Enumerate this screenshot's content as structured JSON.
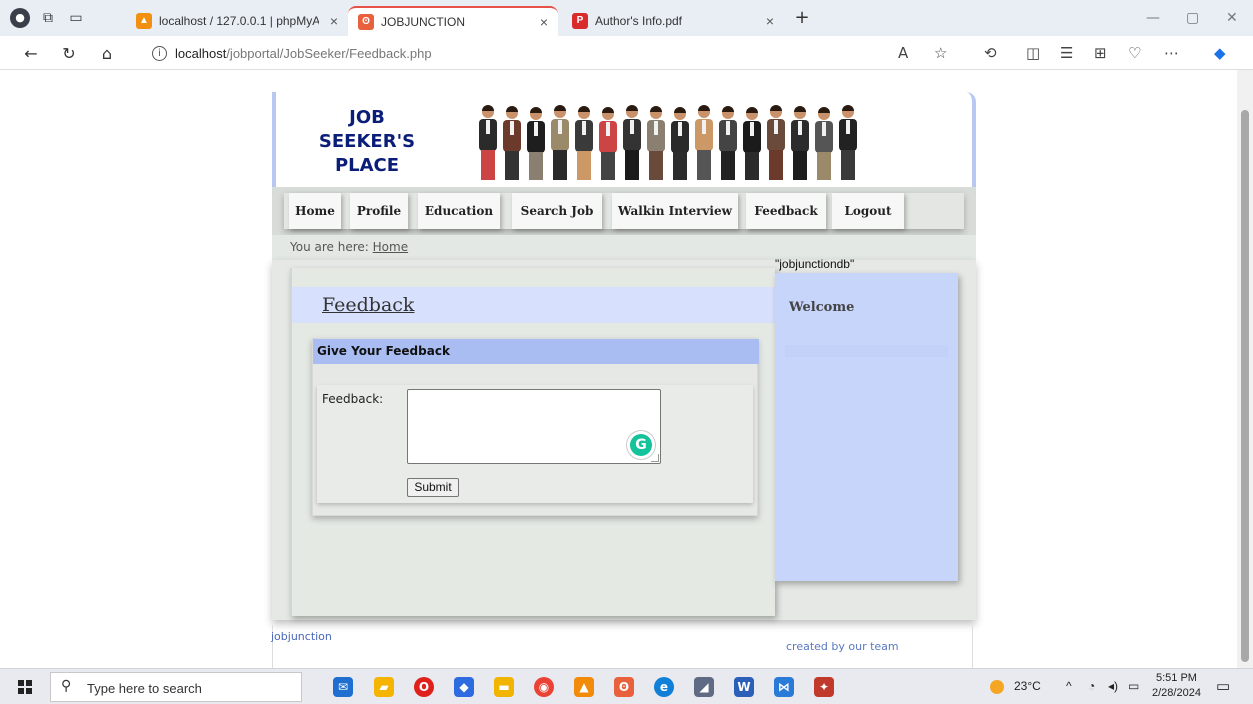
{
  "browser": {
    "tabs": [
      {
        "label": "localhost / 127.0.0.1 | phpMyAdmin",
        "close": "×"
      },
      {
        "label": "JOBJUNCTION",
        "close": "×"
      },
      {
        "label": "Author's Info.pdf",
        "close": "×"
      }
    ],
    "new_tab": "+",
    "url_host": "localhost",
    "url_path": "/jobportal/JobSeeker/Feedback.php"
  },
  "site": {
    "logo_line1": "JOB",
    "logo_line2": "SEEKER'S",
    "logo_line3": "PLACE",
    "menu": [
      "Home",
      "Profile",
      "Education",
      "Search Job",
      "Walkin Interview",
      "Feedback",
      "Logout"
    ],
    "breadcrumb_prefix": "You are here:",
    "breadcrumb_link": "Home",
    "page_title": "Feedback",
    "form_title": "Give Your Feedback",
    "feedback_label": "Feedback:",
    "feedback_value": "",
    "submit_label": "Submit",
    "db_name": "\"jobjunctiondb\"",
    "welcome": "Welcome",
    "footer_left": "jobjunction",
    "footer_right": "created by our team"
  },
  "taskbar": {
    "search_placeholder": "Type here to search",
    "weather": "23°C",
    "time": "5:51 PM",
    "date": "2/28/2024"
  },
  "colors": {
    "accent_blue": "#0a1e78",
    "panel_blue": "#c8d5fb",
    "form_header": "#a9bdf3",
    "grammarly_green": "#15c39a"
  }
}
